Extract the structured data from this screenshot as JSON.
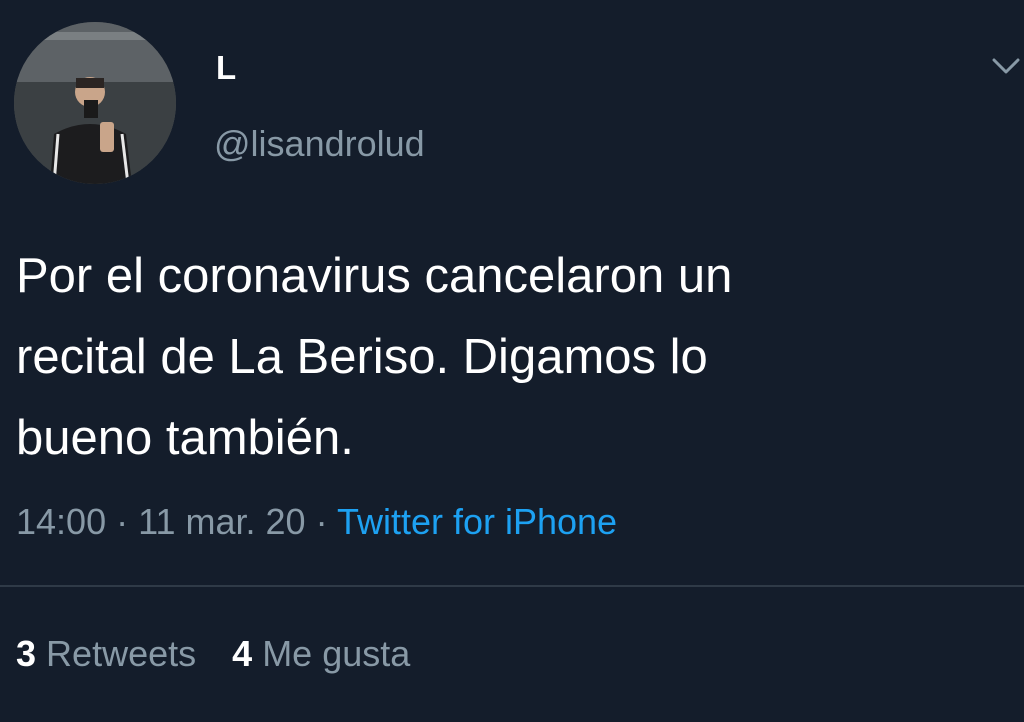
{
  "author": {
    "display_name": "L",
    "handle": "@lisandrolud",
    "avatar_icon": "user-photo-avatar"
  },
  "tweet": {
    "text": "Por el coronavirus cancelaron un\nrecital de La Beriso. Digamos lo\nbueno también.",
    "time": "14:00",
    "date": "11 mar. 20",
    "source": "Twitter for iPhone",
    "separator": "·"
  },
  "stats": {
    "retweets_count": "3",
    "retweets_label": "Retweets",
    "likes_count": "4",
    "likes_label": "Me gusta"
  },
  "colors": {
    "background": "#141d2b",
    "secondary_text": "#8899a6",
    "link": "#1da1f2",
    "divider": "#2f3a47"
  }
}
